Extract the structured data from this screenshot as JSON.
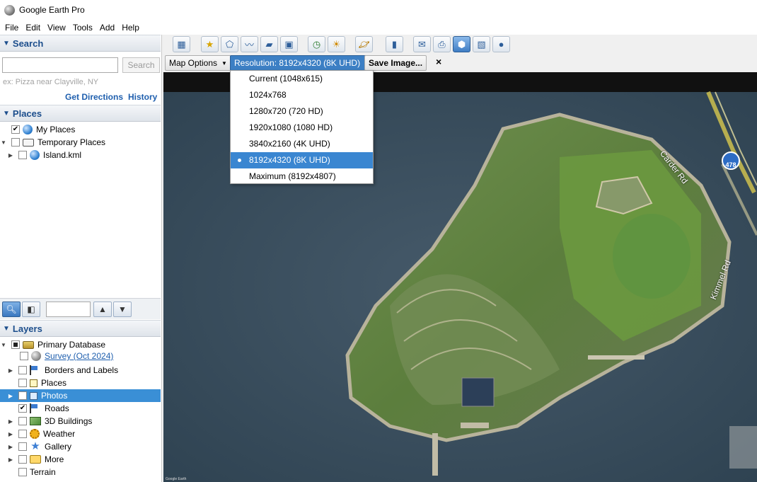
{
  "window": {
    "title": "Google Earth Pro"
  },
  "menu": [
    "File",
    "Edit",
    "View",
    "Tools",
    "Add",
    "Help"
  ],
  "search": {
    "header": "Search",
    "input_value": "",
    "button": "Search",
    "hint": "ex: Pizza near Clayville, NY",
    "get_directions": "Get Directions",
    "history": "History"
  },
  "places": {
    "header": "Places",
    "items": [
      {
        "label": "My Places",
        "checked": true,
        "icon": "globe-icon"
      },
      {
        "label": "Temporary Places",
        "checked": false,
        "icon": "folder-icon"
      },
      {
        "label": "Island.kml",
        "checked": false,
        "icon": "globe-icon"
      }
    ]
  },
  "layers": {
    "header": "Layers",
    "items": [
      {
        "label": "Primary Database",
        "state": "partial",
        "icon": "database-icon"
      },
      {
        "label": "Survey (Oct 2024)",
        "state": "unchecked",
        "icon": "globe-icon",
        "link": true
      },
      {
        "label": "Borders and Labels",
        "state": "unchecked",
        "icon": "flag-icon"
      },
      {
        "label": "Places",
        "state": "unchecked",
        "icon": "places-icon"
      },
      {
        "label": "Photos",
        "state": "unchecked",
        "icon": "photos-icon",
        "selected": true
      },
      {
        "label": "Roads",
        "state": "checked",
        "icon": "flag-icon"
      },
      {
        "label": "3D Buildings",
        "state": "unchecked",
        "icon": "buildings-icon"
      },
      {
        "label": "Weather",
        "state": "unchecked",
        "icon": "weather-icon"
      },
      {
        "label": "Gallery",
        "state": "unchecked",
        "icon": "star-icon"
      },
      {
        "label": "More",
        "state": "unchecked",
        "icon": "more-icon"
      },
      {
        "label": "Terrain",
        "state": "unchecked",
        "icon": ""
      }
    ]
  },
  "snapshot_bar": {
    "map_options": "Map Options",
    "resolution": "Resolution: 8192x4320 (8K UHD)",
    "save_image": "Save Image...",
    "close": "×"
  },
  "resolution_options": [
    {
      "label": "Current (1048x615)",
      "selected": false
    },
    {
      "label": "1024x768",
      "selected": false
    },
    {
      "label": "1280x720 (720 HD)",
      "selected": false
    },
    {
      "label": "1920x1080 (1080 HD)",
      "selected": false
    },
    {
      "label": "3840x2160 (4K UHD)",
      "selected": false
    },
    {
      "label": "8192x4320 (8K UHD)",
      "selected": true
    },
    {
      "label": "Maximum (8192x4807)",
      "selected": false
    }
  ],
  "map": {
    "road_labels": [
      "Carder Rd",
      "Kimmel Rd"
    ],
    "route_shield": "478",
    "attribution": "Google Earth"
  },
  "colors": {
    "selection": "#3a86d1",
    "header_text": "#1c4e8c",
    "link": "#1f5fae"
  }
}
